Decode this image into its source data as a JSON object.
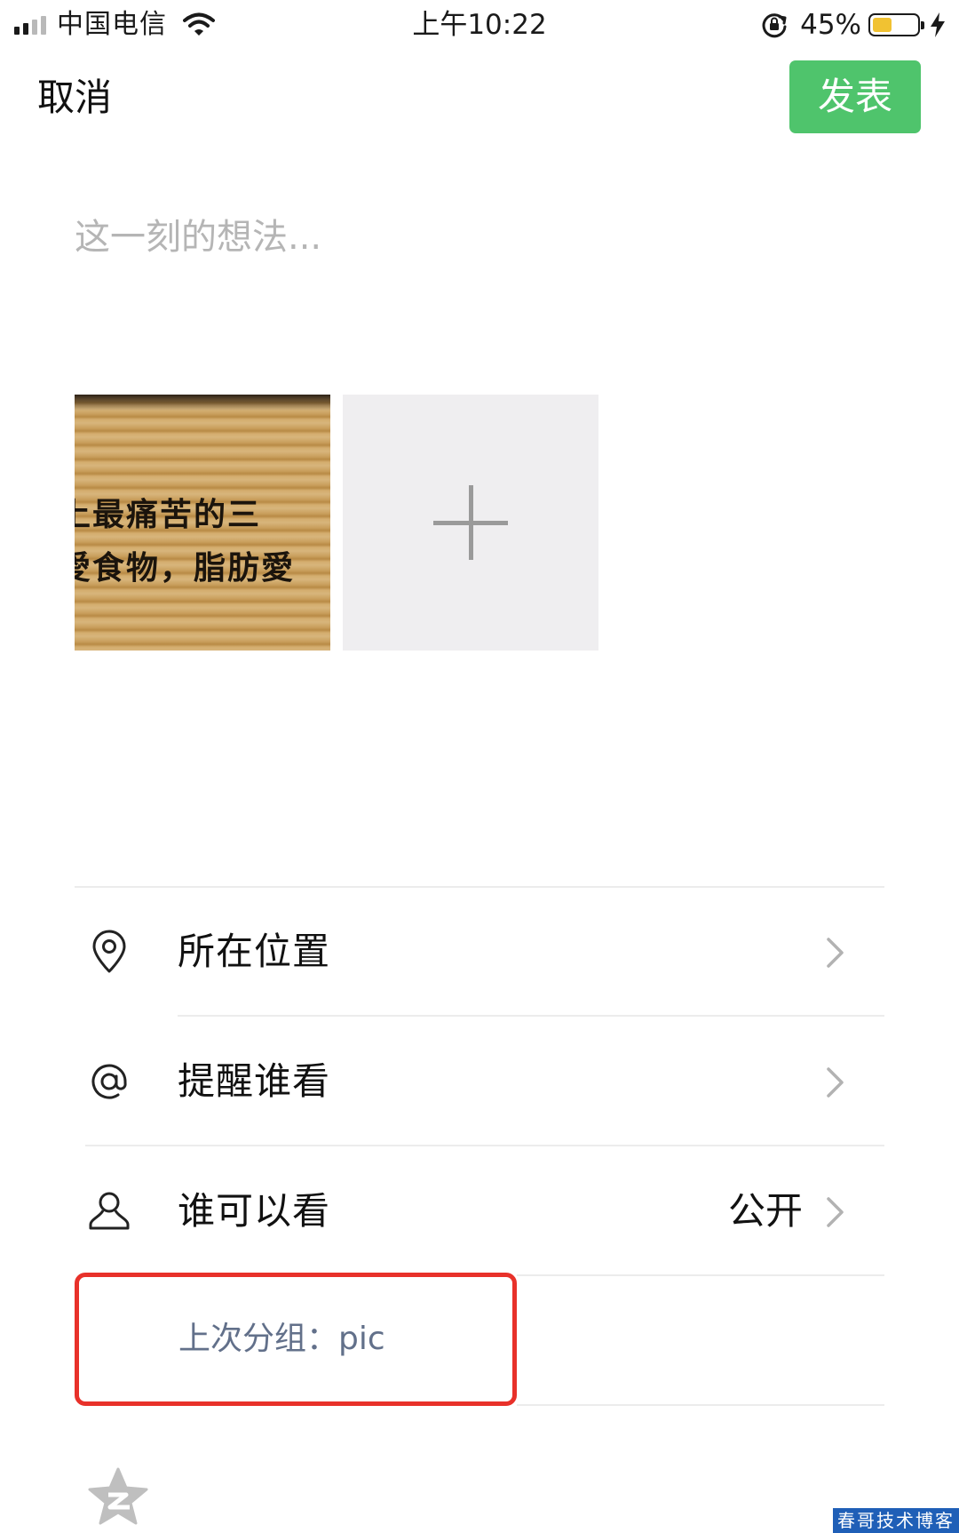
{
  "status_bar": {
    "carrier": "中国电信",
    "time": "上午10:22",
    "battery_percent": "45%",
    "battery_level": 0.45
  },
  "nav": {
    "cancel_label": "取消",
    "publish_label": "发表",
    "publish_color": "#4fc46c"
  },
  "composer": {
    "placeholder": "这一刻的想法...",
    "value": ""
  },
  "photos": {
    "thumbnail_text": [
      "上最痛苦的三",
      "愛食物，脂肪愛"
    ],
    "add_icon": "plus-icon"
  },
  "options": [
    {
      "icon": "location-pin-icon",
      "label": "所在位置",
      "value": ""
    },
    {
      "icon": "at-sign-icon",
      "label": "提醒谁看",
      "value": ""
    },
    {
      "icon": "person-icon",
      "label": "谁可以看",
      "value": "公开"
    }
  ],
  "last_group": {
    "text": "上次分组：pic",
    "highlight_color": "#e8312a"
  },
  "share": {
    "icon": "qzone-star-icon"
  },
  "watermark": "春哥技术博客"
}
